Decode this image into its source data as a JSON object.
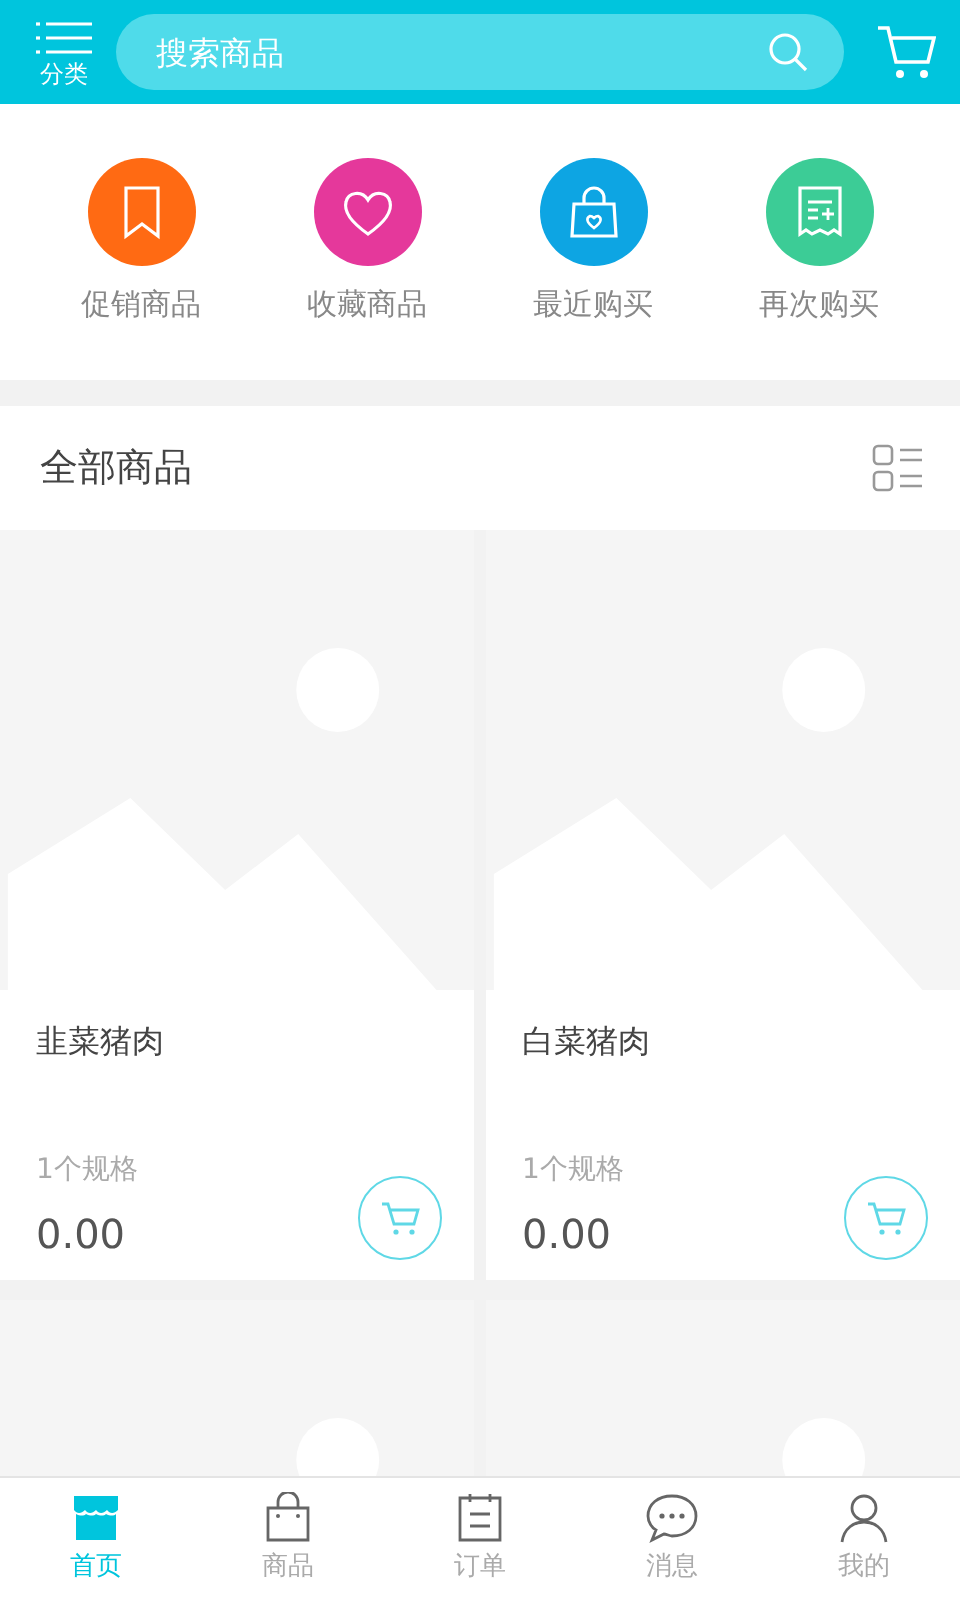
{
  "header": {
    "category_label": "分类",
    "search": {
      "placeholder": "搜索商品"
    }
  },
  "shortcuts": [
    {
      "label": "促销商品",
      "kind": "bookmark",
      "color": "#ff6a13"
    },
    {
      "label": "收藏商品",
      "kind": "heart",
      "color": "#e5389b"
    },
    {
      "label": "最近购买",
      "kind": "bag",
      "color": "#0da5e3"
    },
    {
      "label": "再次购买",
      "kind": "receipt",
      "color": "#3ccc96"
    }
  ],
  "section": {
    "title": "全部商品"
  },
  "products": [
    {
      "kind": "item",
      "name": "韭菜猪肉",
      "spec": "1个规格",
      "price": "0.00"
    },
    {
      "kind": "item",
      "name": "白菜猪肉",
      "spec": "1个规格",
      "price": "0.00"
    },
    {
      "kind": "partial"
    },
    {
      "kind": "partial"
    }
  ],
  "tabs": [
    {
      "label": "首页",
      "kind": "home",
      "selected": true
    },
    {
      "label": "商品",
      "kind": "bag",
      "selected": false
    },
    {
      "label": "订单",
      "kind": "order",
      "selected": false
    },
    {
      "label": "消息",
      "kind": "message",
      "selected": false
    },
    {
      "label": "我的",
      "kind": "user",
      "selected": false
    }
  ]
}
